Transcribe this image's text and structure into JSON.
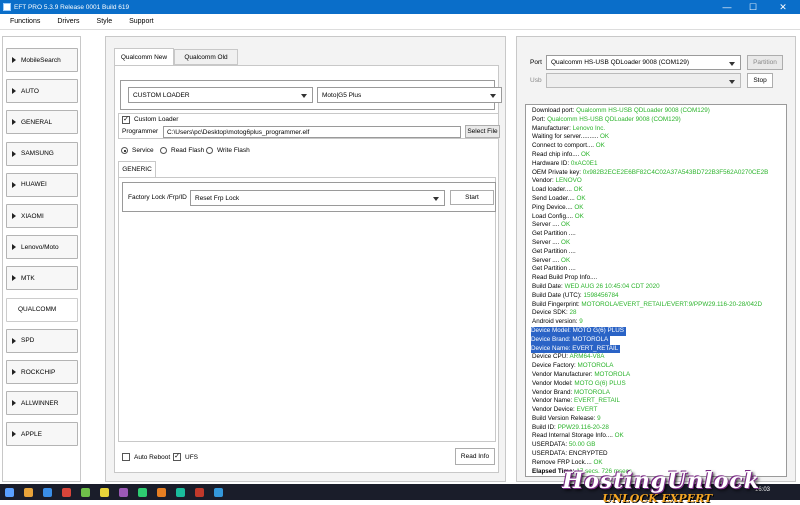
{
  "window": {
    "title": "EFT PRO 5.3.9 Release 0001 Build 619",
    "minimize": "—",
    "maximize": "☐",
    "close": "✕"
  },
  "menu": [
    "Functions",
    "Drivers",
    "Style",
    "Support"
  ],
  "sidebar": {
    "items": [
      {
        "label": "MobileSearch",
        "active": false
      },
      {
        "label": "AUTO",
        "active": false
      },
      {
        "label": "GENERAL",
        "active": false
      },
      {
        "label": "SAMSUNG",
        "active": false
      },
      {
        "label": "HUAWEI",
        "active": false
      },
      {
        "label": "XIAOMI",
        "active": false
      },
      {
        "label": "Lenovo/Moto",
        "active": false
      },
      {
        "label": "MTK",
        "active": false
      },
      {
        "label": "QUALCOMM",
        "active": true
      },
      {
        "label": "SPD",
        "active": false
      },
      {
        "label": "ROCKCHIP",
        "active": false
      },
      {
        "label": "ALLWINNER",
        "active": false
      },
      {
        "label": "APPLE",
        "active": false
      }
    ]
  },
  "center": {
    "tabs": [
      "Qualcomm New",
      "Qualcomm Old"
    ],
    "loader_select": "CUSTOM LOADER",
    "model_select": "Moto|G5 Plus",
    "custom_loader_label": "Custom Loader",
    "custom_loader_checked": "✓",
    "programmer_label": "Programmer",
    "programmer_path": "C:\\Users\\pc\\Desktop\\motog6plus_programmer.elf",
    "select_file": "Select File",
    "modes": [
      "Service",
      "Read Flash",
      "Write Flash"
    ],
    "subtab": "GENERIC",
    "frp_label": "Factory Lock /Frp/ID",
    "frp_select": "Reset Frp Lock",
    "start": "Start",
    "auto_reboot": "Auto Reboot",
    "ufs": "UFS",
    "ufs_checked": "✓",
    "read_info": "Read Info"
  },
  "right": {
    "port_label": "Port",
    "port_value": "Qualcomm HS-USB QDLoader 9008 (COM129)",
    "partition": "Partition",
    "usb_label": "Usb",
    "stop": "Stop"
  },
  "log": [
    {
      "k": "Download port: ",
      "v": "Qualcomm HS-USB QDLoader 9008 (COM129)"
    },
    {
      "k": "Port: ",
      "v": "Qualcomm HS-USB QDLoader 9008 (COM129)"
    },
    {
      "k": "Manufacturer: ",
      "v": "Lenovo Inc."
    },
    {
      "k": "Waiting for server.......... ",
      "v": "OK"
    },
    {
      "k": "Connect to comport.... ",
      "v": "OK"
    },
    {
      "k": "Read chip info.... ",
      "v": "OK"
    },
    {
      "k": "Hardware ID: ",
      "v": "0xAC0E1"
    },
    {
      "k": "OEM Private key: ",
      "v": "0x982B2ECE2E6BF82C4C02A37A543BD722B3F562A0270CE2B"
    },
    {
      "k": "Vendor: ",
      "v": "LENOVO"
    },
    {
      "k": "Load loader.... ",
      "v": "OK"
    },
    {
      "k": "Send Loader.... ",
      "v": "OK"
    },
    {
      "k": "Ping Device.... ",
      "v": "OK"
    },
    {
      "k": "Load Config.... ",
      "v": "OK"
    },
    {
      "k": "Server .... ",
      "v": "OK"
    },
    {
      "k": "Get Partition .... ",
      "v": ""
    },
    {
      "k": "Server .... ",
      "v": "OK"
    },
    {
      "k": "Get Partition .... ",
      "v": ""
    },
    {
      "k": "Server .... ",
      "v": "OK"
    },
    {
      "k": "Get Partition .... ",
      "v": ""
    },
    {
      "k": "Read Build Prop Info....",
      "v": ""
    },
    {
      "k": " Build Date: ",
      "v": "WED AUG 26 10:45:04 CDT 2020"
    },
    {
      "k": " Build Date (UTC): ",
      "v": "1598456784"
    },
    {
      "k": " Build Fingerprint: ",
      "v": "MOTOROLA/EVERT_RETAIL/EVERT:9/PPW29.116-20-28/042D"
    },
    {
      "k": " Device SDK: ",
      "v": "28"
    },
    {
      "k": " Android version: ",
      "v": "9"
    },
    {
      "k": " Device Model: ",
      "v": "MOTO G(6) PLUS",
      "hl": true
    },
    {
      "k": " Device Brand: ",
      "v": "MOTOROLA",
      "hl": true
    },
    {
      "k": " Device Name: ",
      "v": "EVERT_RETAIL",
      "hl": true
    },
    {
      "k": " Device CPU: ",
      "v": "ARM64-V8A"
    },
    {
      "k": " Device Factory: ",
      "v": "MOTOROLA"
    },
    {
      "k": " Vendor Manufacturer: ",
      "v": "MOTOROLA"
    },
    {
      "k": " Vendor Model: ",
      "v": "MOTO G(6) PLUS"
    },
    {
      "k": " Vendor Brand: ",
      "v": "MOTOROLA"
    },
    {
      "k": " Vendor Name: ",
      "v": "EVERT_RETAIL"
    },
    {
      "k": " Vendor Device: ",
      "v": "EVERT"
    },
    {
      "k": " Build Version Release: ",
      "v": "9"
    },
    {
      "k": " Build ID: ",
      "v": "PPW29.116-20-28"
    },
    {
      "k": "Read Internal Storage Info.... ",
      "v": "OK"
    },
    {
      "k": "USERDATA: ",
      "v": "50.00 GB"
    },
    {
      "k": "USERDATA: ENCRYPTED",
      "v": ""
    },
    {
      "k": "Remove FRP Lock.... ",
      "v": "OK"
    },
    {
      "k": "Elapsed Time: ",
      "v": "17 secs. 726 msecs"
    }
  ],
  "watermark": {
    "main": "HostingUnlock",
    "sub": "UNLOCK EXPERT"
  },
  "clock": "16:03",
  "colors": {
    "titlebar": "#0a6ec9",
    "ok": "#2bb32b",
    "highlight": "#2a63c6"
  }
}
